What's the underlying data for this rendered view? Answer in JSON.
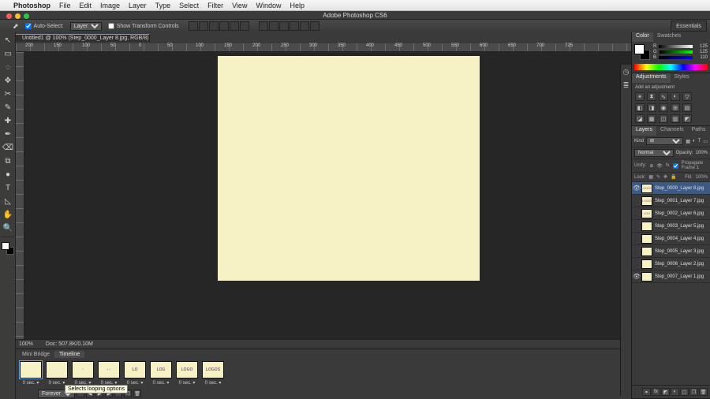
{
  "mac": {
    "appname": "Photoshop",
    "items": [
      "File",
      "Edit",
      "Image",
      "Layer",
      "Type",
      "Select",
      "Filter",
      "View",
      "Window",
      "Help"
    ]
  },
  "appTitle": "Adobe Photoshop CS6",
  "options": {
    "autoSelect": "Auto-Select:",
    "autoSelectVal": "Layer",
    "showTransform": "Show Transform Controls"
  },
  "essentials": "Essentials",
  "docTab": "Untitled1 @ 100% (Step_0000_Layer 8.jpg, RGB/8) *",
  "rulerLabels": [
    "200",
    "150",
    "100",
    "50",
    "0",
    "50",
    "100",
    "150",
    "200",
    "250",
    "300",
    "350",
    "400",
    "450",
    "500",
    "550",
    "600",
    "650",
    "700",
    "725"
  ],
  "status": {
    "zoom": "100%",
    "doc": "Doc: 507.8K/0.10M"
  },
  "lower": {
    "tabs": [
      "Mini Bridge",
      "Timeline"
    ],
    "frames": [
      {
        "dur": "0 sec.",
        "txt": ""
      },
      {
        "dur": "0 sec.",
        "txt": ""
      },
      {
        "dur": "0 sec.",
        "txt": "·"
      },
      {
        "dur": "0 sec.",
        "txt": "- ·"
      },
      {
        "dur": "0 sec.",
        "txt": "LO"
      },
      {
        "dur": "0 sec.",
        "txt": "LOG"
      },
      {
        "dur": "0 sec.",
        "txt": "LOGO"
      },
      {
        "dur": "0 sec.",
        "txt": "LOGOS"
      }
    ],
    "loop": "Forever",
    "tooltip": "Selects looping options"
  },
  "panels": {
    "colorTabs": [
      "Color",
      "Swatches"
    ],
    "rgb": [
      {
        "l": "R",
        "v": "125"
      },
      {
        "l": "G",
        "v": "125"
      },
      {
        "l": "B",
        "v": "110"
      }
    ],
    "adjTabs": [
      "Adjustments",
      "Styles"
    ],
    "adjHead": "Add an adjustment",
    "layerTabs": [
      "Layers",
      "Channels",
      "Paths"
    ],
    "kind": "Kind",
    "normal": "Normal",
    "opacity": "Opacity:",
    "opv": "100%",
    "unify": "Unify:",
    "propagate": "Propagate Frame 1",
    "lock": "Lock:",
    "fill": "Fill:",
    "fv": "100%",
    "layers": [
      {
        "name": "Step_0000_Layer 8.jpg",
        "sel": true,
        "vis": true,
        "t": "LOGOS"
      },
      {
        "name": "Step_0001_Layer 7.jpg",
        "sel": false,
        "vis": false,
        "t": "LOGO"
      },
      {
        "name": "Step_0002_Layer 6.jpg",
        "sel": false,
        "vis": false,
        "t": "LOG"
      },
      {
        "name": "Step_0003_Layer 5.jpg",
        "sel": false,
        "vis": false,
        "t": ""
      },
      {
        "name": "Step_0004_Layer 4.jpg",
        "sel": false,
        "vis": false,
        "t": ""
      },
      {
        "name": "Step_0005_Layer 3.jpg",
        "sel": false,
        "vis": false,
        "t": ""
      },
      {
        "name": "Step_0006_Layer 2.jpg",
        "sel": false,
        "vis": false,
        "t": ""
      },
      {
        "name": "Step_0007_Layer 1.jpg",
        "sel": false,
        "vis": true,
        "t": ""
      }
    ]
  },
  "tools": [
    "↖",
    "▭",
    "◌",
    "✥",
    "✂",
    "✎",
    "✚",
    "✒",
    "⌫",
    "⧉",
    "●",
    "T",
    "◺",
    "✋",
    "🔍"
  ]
}
